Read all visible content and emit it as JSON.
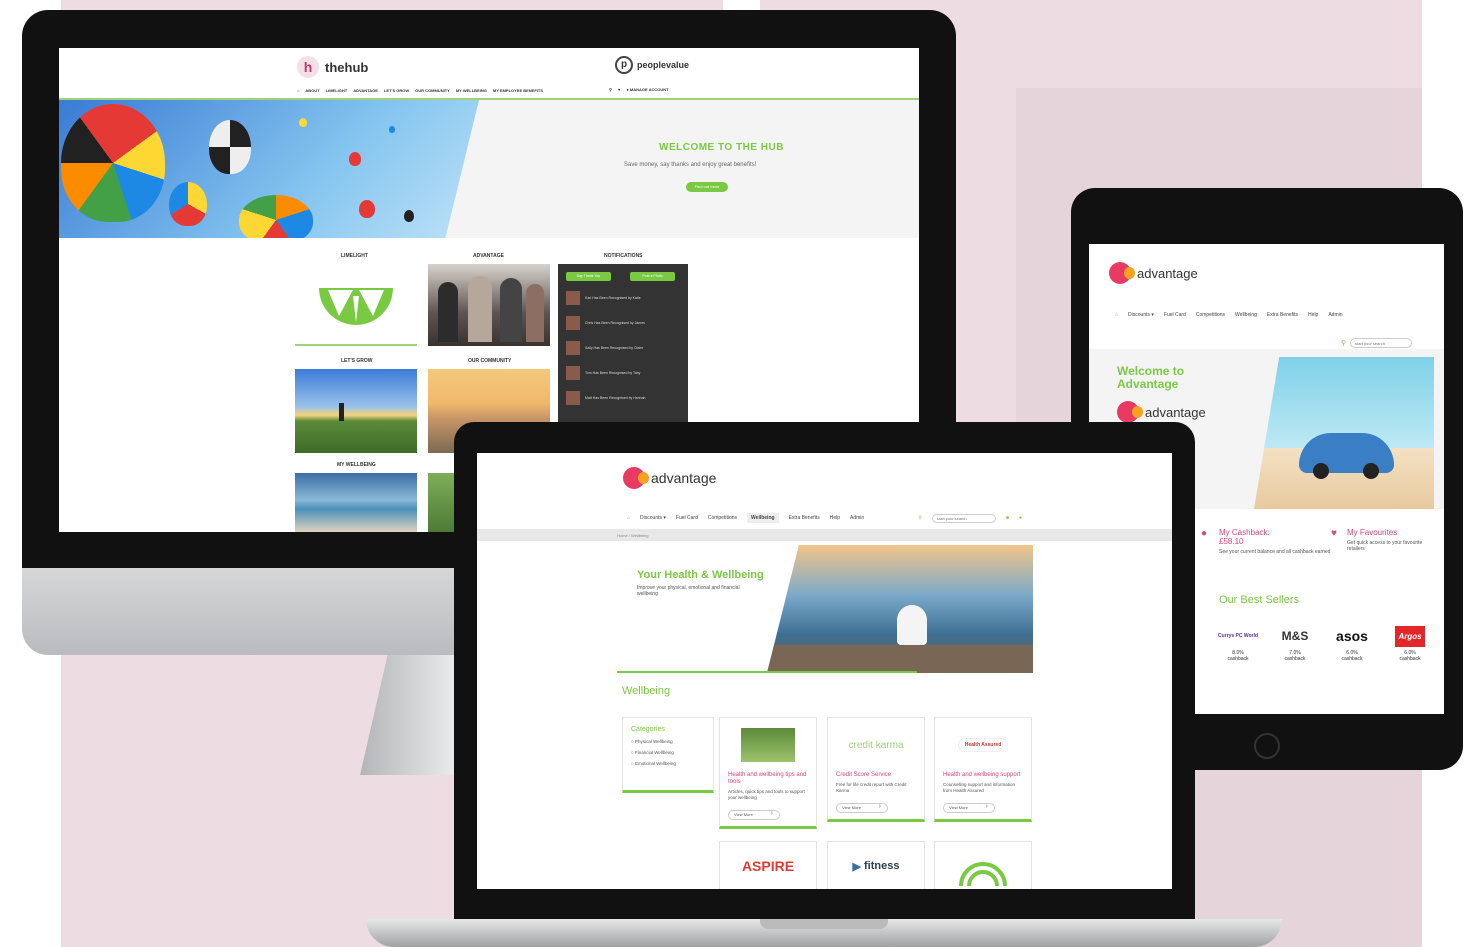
{
  "colors": {
    "accent": "#7ac943",
    "pink": "#d8467b",
    "brand_red": "#e93a64",
    "brand_orange": "#f7a321"
  },
  "imac": {
    "hub_logo_letter": "h",
    "hub_logo_text": "thehub",
    "partner_logo_letter": "p",
    "partner_logo_text": "peoplevalue",
    "nav": [
      "ABOUT",
      "LIMELIGHT",
      "ADVANTAGE",
      "LET'S GROW",
      "OUR COMMUNITY",
      "MY WELLBEING",
      "MY EMPLOYEE BENEFITS"
    ],
    "account_label": "MANAGE ACCOUNT",
    "hero_title": "WELCOME TO THE HUB",
    "hero_subtitle": "Save money, say thanks and enjoy great benefits!",
    "hero_button": "Find out more",
    "sections": {
      "limelight": "LIMELIGHT",
      "advantage": "ADVANTAGE",
      "notifications": "NOTIFICATIONS",
      "lets_grow": "LET'S GROW",
      "our_community": "OUR COMMUNITY",
      "my_wellbeing": "MY WELLBEING"
    },
    "notif_buttons": [
      "Say Thank You",
      "Post a Photo"
    ],
    "notifications": [
      "Karl Has Been Recognised by Katie",
      "Chris Has Been Recognised by James",
      "Sally Has Been Recognised by Claire",
      "Tom Has Been Recognised by Toby",
      "Matt Has Been Recognised by Hannah"
    ]
  },
  "laptop": {
    "logo_text": "advantage",
    "nav": [
      "Discounts ▾",
      "Fuel Card",
      "Competitions",
      "Wellbeing",
      "Extra Benefits",
      "Help",
      "Admin"
    ],
    "search_placeholder": "start your search",
    "breadcrumb": "Home  /  Wellbeing",
    "hero_title": "Your Health & Wellbeing",
    "hero_text": "Improve your physical, emotional and financial wellbeing",
    "section_title": "Wellbeing",
    "categories_title": "Categories",
    "categories": [
      "Physical Wellbeing",
      "Financial Wellbeing",
      "Emotional Wellbeing"
    ],
    "cards": [
      {
        "logo": "",
        "title": "Health and wellbeing tips and tools",
        "text": "Articles, quick tips and tools to support your wellbeing",
        "button": "View More"
      },
      {
        "logo": "credit karma",
        "title": "Credit Score Service",
        "text": "Free for life credit report with Credit Karma",
        "button": "View More"
      },
      {
        "logo": "Health Assured",
        "title": "Health and wellbeing support",
        "text": "Counselling support and information from Health Assured",
        "button": "View More"
      }
    ],
    "row2_logos": [
      "ASPIRE",
      "fitness",
      ""
    ]
  },
  "tablet": {
    "logo_text": "advantage",
    "nav": [
      "Discounts ▾",
      "Fuel Card",
      "Competitions",
      "Wellbeing",
      "Extra Benefits",
      "Help",
      "Admin"
    ],
    "search_placeholder": "start your search",
    "hero_title_line1": "Welcome to",
    "hero_title_line2": "Advantage",
    "hero_logo_text": "advantage",
    "feature1_title": "My Cashback:",
    "feature1_value": "£58.10",
    "feature1_text": "See your current balance and all cashback earned",
    "feature2_title": "My Favourites",
    "feature2_text": "Get quick access to your favourite retailers",
    "best_sellers_title": "Our Best Sellers",
    "sellers": [
      {
        "name": "Currys PC World",
        "rate": "8.0%",
        "label": "cashback"
      },
      {
        "name": "M&S",
        "rate": "7.0%",
        "label": "cashback"
      },
      {
        "name": "asos",
        "rate": "6.0%",
        "label": "cashback"
      },
      {
        "name": "Argos",
        "rate": "6.0%",
        "label": "cashback"
      }
    ]
  }
}
